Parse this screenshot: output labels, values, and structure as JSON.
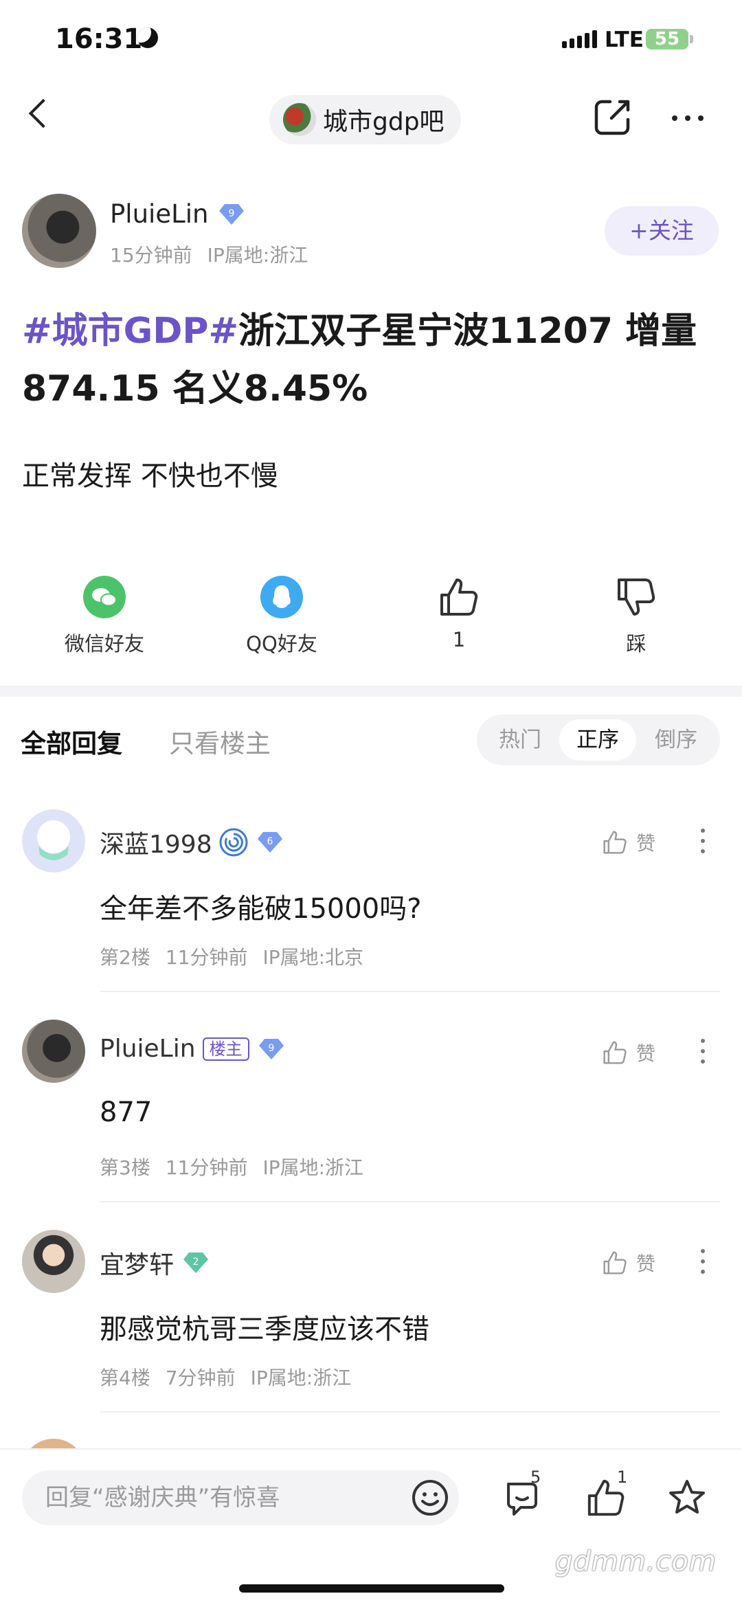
{
  "status_bar": {
    "time": "16:31",
    "network": "LTE",
    "battery": "55"
  },
  "header": {
    "forum_name": "城市gdp吧"
  },
  "post": {
    "author": "PluieLin",
    "author_level": "9",
    "time": "15分钟前",
    "ip": "IP属地:浙江",
    "follow_label": "+关注",
    "title_tag": "#城市GDP#",
    "title_rest": "浙江双子星宁波11207 增量874.15 名义8.45%",
    "body": "正常发挥 不快也不慢"
  },
  "actions": {
    "wechat_label": "微信好友",
    "qq_label": "QQ好友",
    "like_count": "1",
    "dislike_label": "踩"
  },
  "tabs": {
    "all_label": "全部回复",
    "owner_only_label": "只看楼主",
    "sort_options": [
      "热门",
      "正序",
      "倒序"
    ],
    "sort_selected": "正序"
  },
  "replies": [
    {
      "name": "深蓝1998",
      "level": "6",
      "text": "全年差不多能破15000吗?",
      "floor": "第2楼",
      "time": "11分钟前",
      "ip": "IP属地:北京",
      "like_label": "赞"
    },
    {
      "name": "PluieLin",
      "owner_tag": "楼主",
      "level": "9",
      "text": "877",
      "floor": "第3楼",
      "time": "11分钟前",
      "ip": "IP属地:浙江",
      "like_label": "赞"
    },
    {
      "name": "宜梦轩",
      "level": "2",
      "text": "那感觉杭哥三季度应该不错",
      "floor": "第4楼",
      "time": "7分钟前",
      "ip": "IP属地:浙江",
      "like_label": "赞"
    }
  ],
  "bottom_bar": {
    "reply_placeholder": "回复“感谢庆典”有惊喜",
    "comment_count": "5",
    "like_count": "1"
  },
  "watermark": "gdmm.com",
  "colors": {
    "accent": "#6a54c8",
    "badge_blue": "#7a9cf0",
    "badge_green": "#5cc6a2"
  },
  "icons": [
    "back-icon",
    "edit-icon",
    "more-icon",
    "wechat-icon",
    "qq-icon",
    "thumb-up-icon",
    "thumb-down-icon",
    "emoji-icon",
    "comment-icon",
    "star-icon"
  ]
}
